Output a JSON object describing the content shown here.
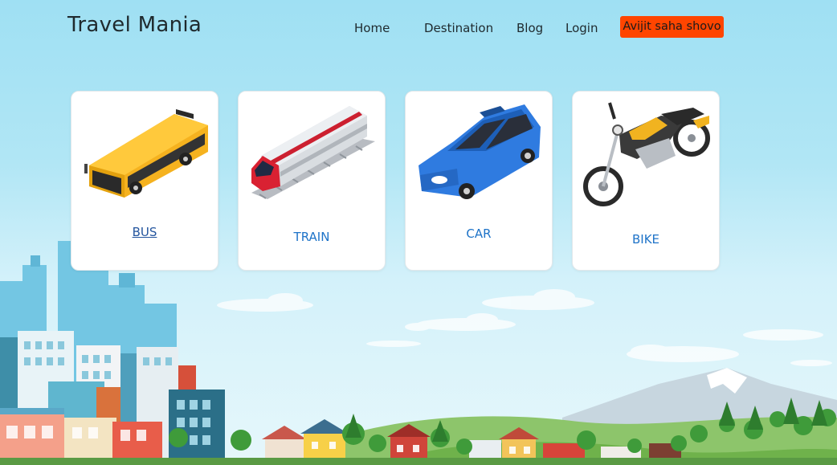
{
  "brand": {
    "title": "Travel Mania"
  },
  "nav": {
    "items": [
      {
        "label": "Home"
      },
      {
        "label": "Destination"
      },
      {
        "label": "Blog"
      },
      {
        "label": "Login"
      }
    ],
    "user_button": "Avijit saha shovo"
  },
  "vehicles": [
    {
      "label": "BUS",
      "icon": "bus-icon",
      "hovered": true
    },
    {
      "label": "TRAIN",
      "icon": "train-icon"
    },
    {
      "label": "CAR",
      "icon": "car-icon"
    },
    {
      "label": "BIKE",
      "icon": "motorbike-icon"
    }
  ],
  "colors": {
    "sky": "#a6e2f4",
    "accent_button": "#ff4500",
    "link_blue": "#1e73c8",
    "bus": "#f5b21f",
    "train_stripe": "#cc2030",
    "car": "#2f7be0",
    "bike_tank": "#f1b320"
  }
}
